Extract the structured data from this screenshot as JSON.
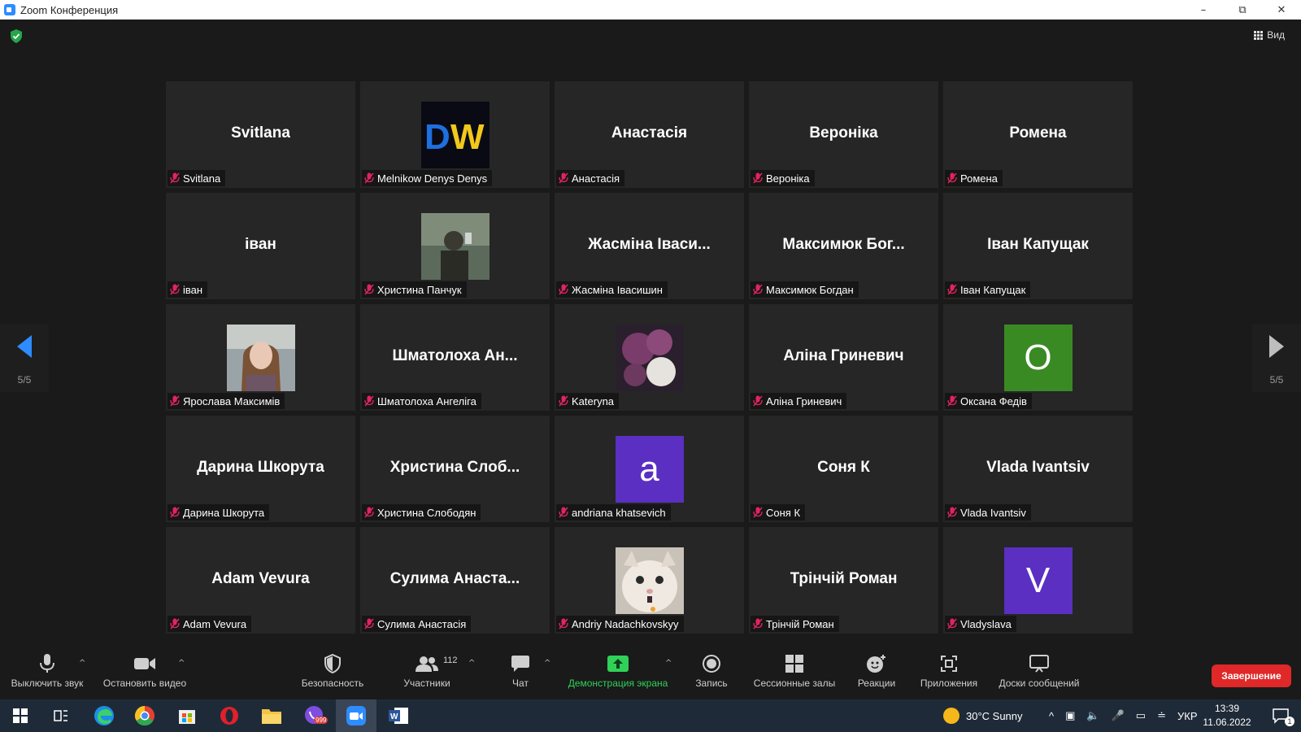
{
  "window": {
    "title": "Zoom Конференция"
  },
  "view_button": {
    "label": "Вид"
  },
  "navigation": {
    "left_page": "5/5",
    "right_page": "5/5"
  },
  "participants": [
    {
      "display": "Svitlana",
      "label": "Svitlana",
      "kind": "name"
    },
    {
      "display": "",
      "label": "Melnikow Denys Denys",
      "kind": "image",
      "image": "dw-logo"
    },
    {
      "display": "Анастасія",
      "label": "Анастасія",
      "kind": "name"
    },
    {
      "display": "Вероніка",
      "label": "Вероніка",
      "kind": "name"
    },
    {
      "display": "Ромена",
      "label": "Ромена",
      "kind": "name"
    },
    {
      "display": "іван",
      "label": "іван",
      "kind": "name"
    },
    {
      "display": "",
      "label": "Христина Панчук",
      "kind": "image",
      "image": "person-photo"
    },
    {
      "display": "Жасміна Іваси...",
      "label": "Жасміна Івасишин",
      "kind": "name"
    },
    {
      "display": "Максимюк Бог...",
      "label": "Максимюк Богдан",
      "kind": "name"
    },
    {
      "display": "Іван Капущак",
      "label": "Іван Капущак",
      "kind": "name"
    },
    {
      "display": "",
      "label": "Ярослава Максимів",
      "kind": "image",
      "image": "girl-photo"
    },
    {
      "display": "Шматолоха Ан...",
      "label": "Шматолоха Ангеліга",
      "kind": "name"
    },
    {
      "display": "",
      "label": "Kateryna",
      "kind": "image",
      "image": "flowers-photo"
    },
    {
      "display": "Аліна Гриневич",
      "label": "Аліна Гриневич",
      "kind": "name"
    },
    {
      "display": "O",
      "label": "Оксана Федів",
      "kind": "letter",
      "color": "#3a8a24"
    },
    {
      "display": "Дарина Шкорута",
      "label": "Дарина Шкорута",
      "kind": "name"
    },
    {
      "display": "Христина Слоб...",
      "label": "Христина Слободян",
      "kind": "name"
    },
    {
      "display": "a",
      "label": "andriana khatsevich",
      "kind": "letter",
      "color": "#5a2fc2"
    },
    {
      "display": "Соня К",
      "label": "Соня К",
      "kind": "name"
    },
    {
      "display": "Vlada Ivantsiv",
      "label": "Vlada Ivantsiv",
      "kind": "name"
    },
    {
      "display": "Adam Vevura",
      "label": "Adam Vevura",
      "kind": "name"
    },
    {
      "display": "Сулима Анаста...",
      "label": "Сулима Анастасія",
      "kind": "name"
    },
    {
      "display": "",
      "label": "Andriy Nadachkovskyy",
      "kind": "image",
      "image": "cat-photo"
    },
    {
      "display": "Трінчій Роман",
      "label": "Трінчій Роман",
      "kind": "name"
    },
    {
      "display": "V",
      "label": "Vladyslava",
      "kind": "letter",
      "color": "#5a2fc2"
    }
  ],
  "toolbar": {
    "mute": "Выключить звук",
    "video": "Остановить видео",
    "security": "Безопасность",
    "participants": "Участники",
    "participants_count": "112",
    "chat": "Чат",
    "share": "Демонстрация экрана",
    "record": "Запись",
    "breakout": "Сессионные залы",
    "reactions": "Реакции",
    "apps": "Приложения",
    "whiteboards": "Доски сообщений",
    "end": "Завершение"
  },
  "taskbar": {
    "weather": "30°C  Sunny",
    "language": "УКР",
    "time": "13:39",
    "date": "11.06.2022",
    "viber_badge": "999",
    "notification_count": "1"
  },
  "colors": {
    "accent": "#2d8cff",
    "end": "#e02828",
    "share": "#30d158",
    "muted": "#e0245e"
  }
}
